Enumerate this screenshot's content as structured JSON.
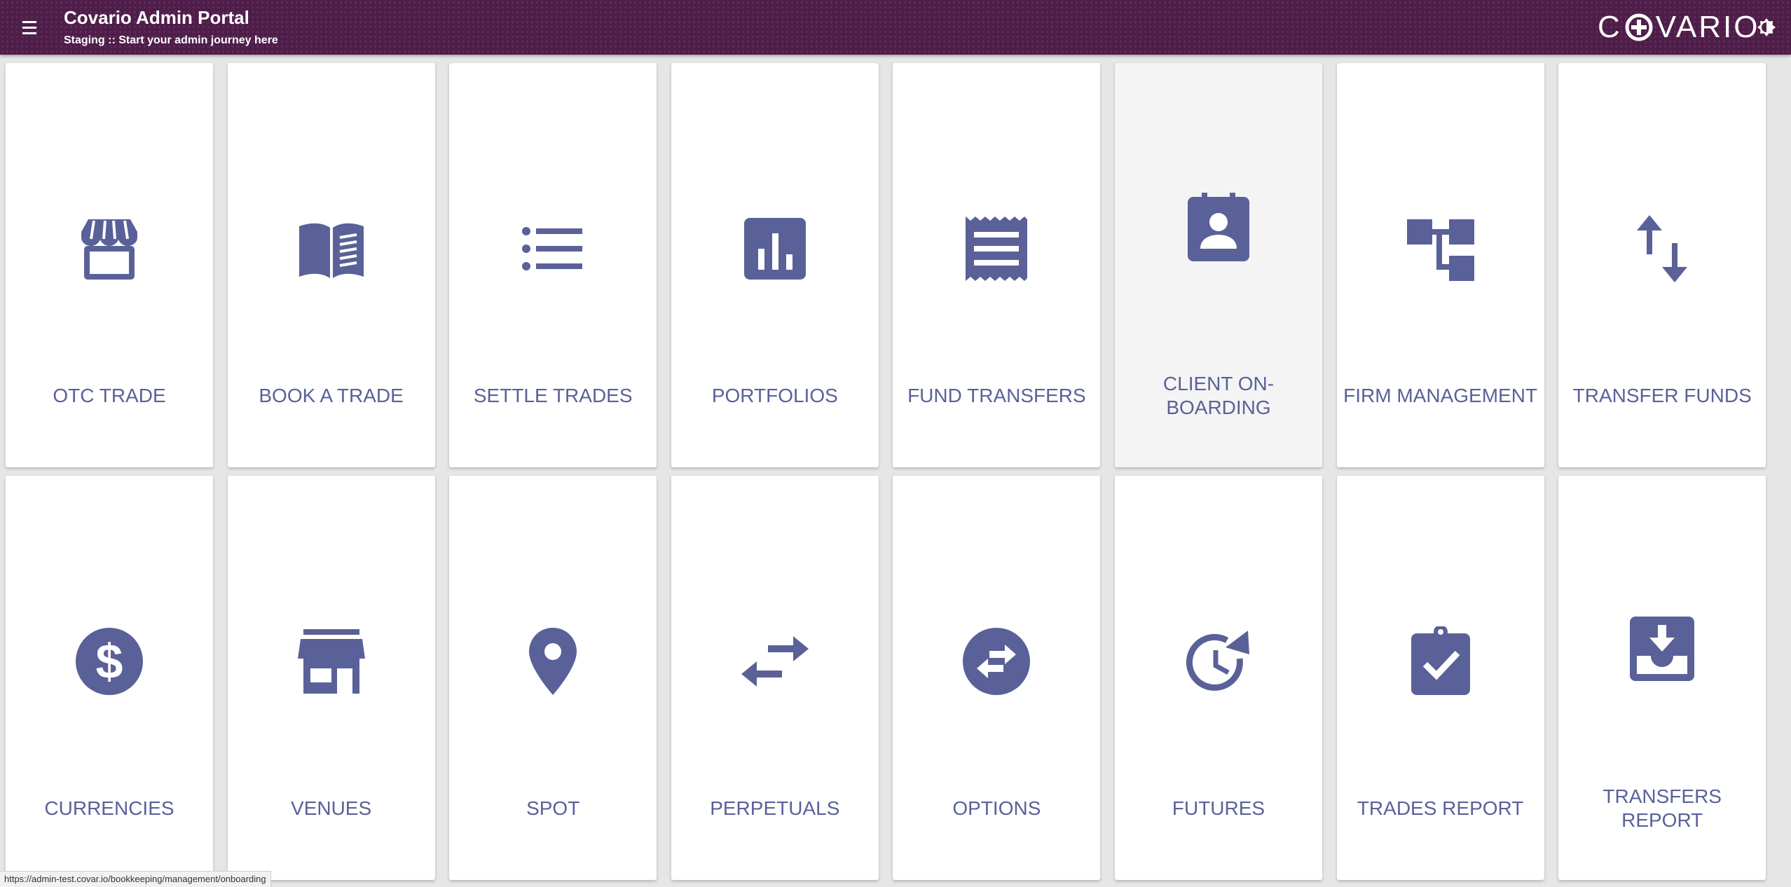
{
  "header": {
    "title": "Covario Admin Portal",
    "subtitle": "Staging :: Start your admin journey here",
    "logo_text_pre": "C",
    "logo_text_post": "VARIO"
  },
  "tiles": [
    {
      "label": "OTC TRADE",
      "icon": "storefront-icon"
    },
    {
      "label": "BOOK A TRADE",
      "icon": "book-icon"
    },
    {
      "label": "SETTLE TRADES",
      "icon": "list-icon"
    },
    {
      "label": "PORTFOLIOS",
      "icon": "bar-chart-icon"
    },
    {
      "label": "FUND TRANSFERS",
      "icon": "receipt-icon"
    },
    {
      "label": "CLIENT ON-BOARDING",
      "icon": "contact-card-icon"
    },
    {
      "label": "FIRM MANAGEMENT",
      "icon": "org-tree-icon"
    },
    {
      "label": "TRANSFER FUNDS",
      "icon": "swap-vertical-icon"
    },
    {
      "label": "CURRENCIES",
      "icon": "dollar-icon"
    },
    {
      "label": "VENUES",
      "icon": "store-icon"
    },
    {
      "label": "SPOT",
      "icon": "location-pin-icon"
    },
    {
      "label": "PERPETUALS",
      "icon": "swap-horizontal-icon"
    },
    {
      "label": "OPTIONS",
      "icon": "swap-circle-icon"
    },
    {
      "label": "FUTURES",
      "icon": "clock-arrow-icon"
    },
    {
      "label": "TRADES REPORT",
      "icon": "clipboard-check-icon"
    },
    {
      "label": "TRANSFERS REPORT",
      "icon": "inbox-download-icon"
    }
  ],
  "status_url": "https://admin-test.covar.io/bookkeeping/management/onboarding",
  "colors": {
    "header_bg": "#4f1d4a",
    "icon": "#5a6198",
    "label": "#5a6198"
  }
}
